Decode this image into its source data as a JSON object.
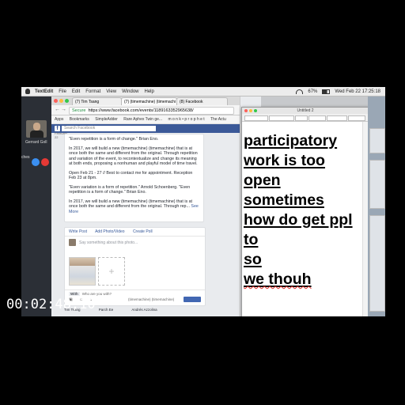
{
  "menubar": {
    "app_name": "TextEdit",
    "items": [
      "File",
      "Edit",
      "Format",
      "View",
      "Window",
      "Help"
    ],
    "clock": "Wed Feb 22  17:25:18",
    "battery": "67%"
  },
  "video_call": {
    "caller_name": "Gerrard Goll",
    "side_label": "ches"
  },
  "browser": {
    "tabs": [
      "(7) Tim Tsang",
      "(7) (timemachine) (timemachi",
      "(8) Facebook"
    ],
    "secure_label": "Secure",
    "url": "https://www.facebook.com/events/1189163352965638/",
    "bookmarks": [
      "Apps",
      "Bookmarks",
      "SimpleAdder",
      "Rare Aphex Twin ge...",
      "m o n k • p r o p h e t",
      "The Actu"
    ]
  },
  "facebook": {
    "search_placeholder": "Search Facebook",
    "left_col_date": "February 22",
    "post_paragraphs": [
      "\"Even repetition is a form of change.\" Brian Eno.",
      "In 2017, we will build a new (timemachine) (timemachine) that is at once both the same and different from the original. Through repetition and variation of the event, to recontextualize and change its meaning at both ends, proposing a nonhuman and playful model of time travel.",
      "Open Feb 21 - 27 // Best to contact me for appointment. Reception Feb 23 at 8pm.",
      "\"Even variation is a form of repetition.\" Arnold Schoenberg. \"Even repetition is a form of change.\" Brian Eno.",
      "In 2017, we will build a new (timemachine) (timemachine) that is at once both the same and different from the original. Through rep..."
    ],
    "see_more": "See More",
    "composer_actions": [
      "Write Post",
      "Add Photo/Video",
      "Create Poll"
    ],
    "composer_placeholder": "Say something about this photo...",
    "add_photo_glyph": "+",
    "with_label": "With",
    "with_placeholder": "Who are you with?",
    "tag_text": "(timemachine) (timemachine)",
    "bottom_names": [
      "Tim Tsang",
      "Parch Ee",
      "Andrés Azzolina"
    ]
  },
  "editor": {
    "title": "Untitled 2",
    "lines": [
      {
        "text": "participatory",
        "misspelled": false
      },
      {
        "text": "work is too",
        "misspelled": false
      },
      {
        "text": "open",
        "misspelled": false
      },
      {
        "text": "sometimes",
        "misspelled": false
      },
      {
        "text": "how do get ppl",
        "misspelled": false
      },
      {
        "text": "to",
        "misspelled": false
      },
      {
        "text": "so",
        "misspelled": false
      },
      {
        "text": "we thouh",
        "misspelled": true
      }
    ]
  },
  "timecode": "00:02:48;10"
}
